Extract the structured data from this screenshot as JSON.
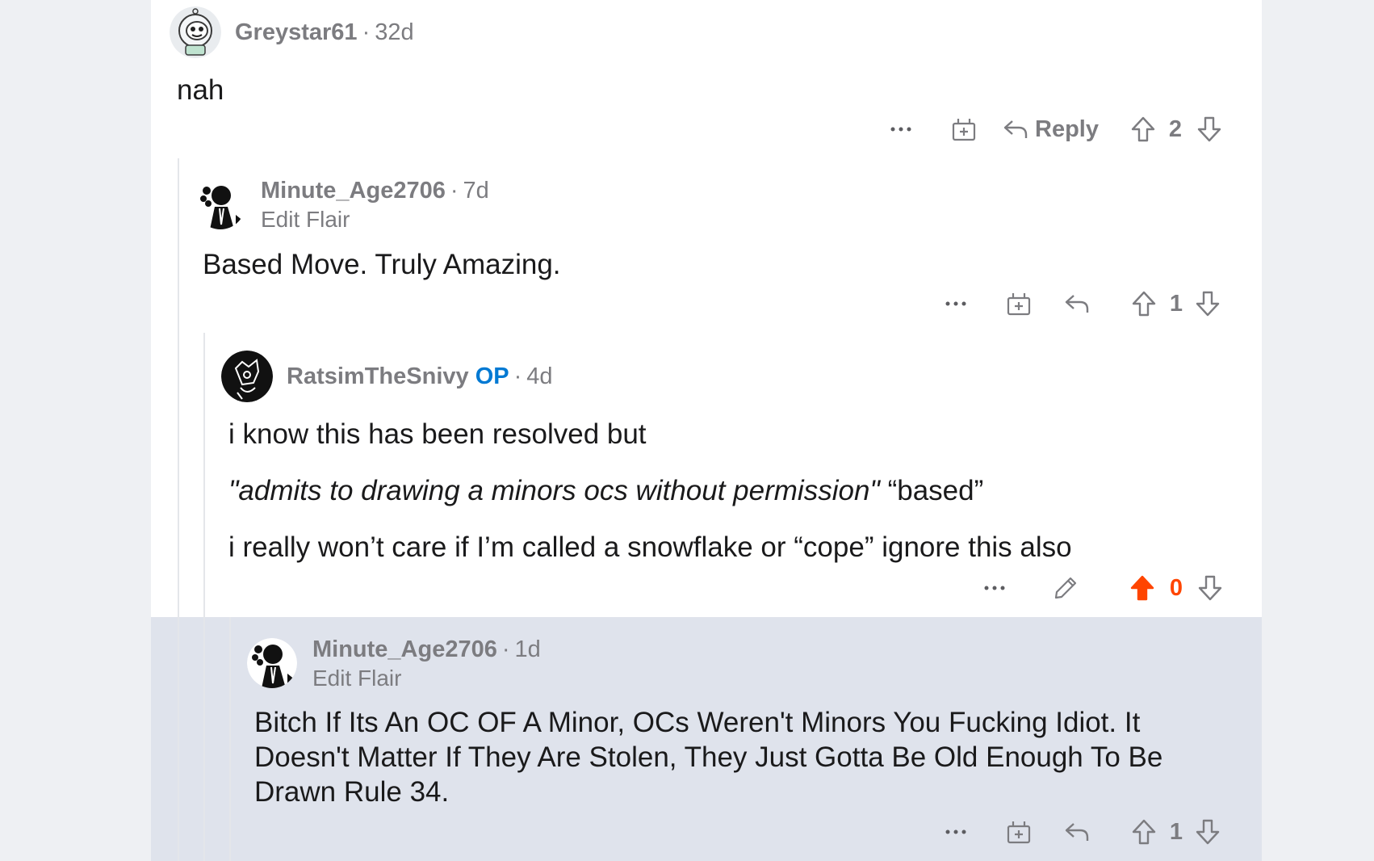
{
  "colors": {
    "page_bg": "#eef0f3",
    "panel_bg": "#ffffff",
    "highlight_bg": "#dfe3ec",
    "op_blue": "#0079d3",
    "upvote_orange": "#ff4500",
    "meta_gray": "#7c7c80"
  },
  "comments": [
    {
      "username": "Greystar61",
      "age": "32d",
      "body": [
        "nah"
      ],
      "actions": {
        "more": "···",
        "reply_label": "Reply",
        "score": "2"
      }
    },
    {
      "username": "Minute_Age2706",
      "age": "7d",
      "flair": "Edit Flair",
      "body": [
        "Based Move. Truly Amazing."
      ],
      "actions": {
        "more": "···",
        "score": "1"
      }
    },
    {
      "username": "RatsimTheSnivy",
      "op_badge": "OP",
      "age": "4d",
      "body": {
        "line1": "i know this has been resolved but",
        "line2_italic": "\"admits to drawing a minors ocs without permission\"",
        "line2_rest": " “based”",
        "line3": "i really won’t care if I’m called a snowflake or “cope” ignore this also"
      },
      "actions": {
        "more": "···",
        "score": "0",
        "upvoted": true
      }
    },
    {
      "username": "Minute_Age2706",
      "age": "1d",
      "flair": "Edit Flair",
      "body": [
        "Bitch If Its An OC OF A Minor, OCs Weren't Minors You Fucking Idiot. It",
        "Doesn't Matter If They Are Stolen, They Just Gotta Be Old Enough To Be",
        "Drawn Rule 34."
      ],
      "actions": {
        "more": "···",
        "score": "1"
      },
      "highlighted": true
    }
  ],
  "icons": [
    "astronaut-avatar-icon",
    "sketch-avatar-icon",
    "snivy-avatar-icon",
    "more-icon",
    "award-icon",
    "reply-icon",
    "upvote-icon",
    "downvote-icon",
    "edit-icon"
  ]
}
